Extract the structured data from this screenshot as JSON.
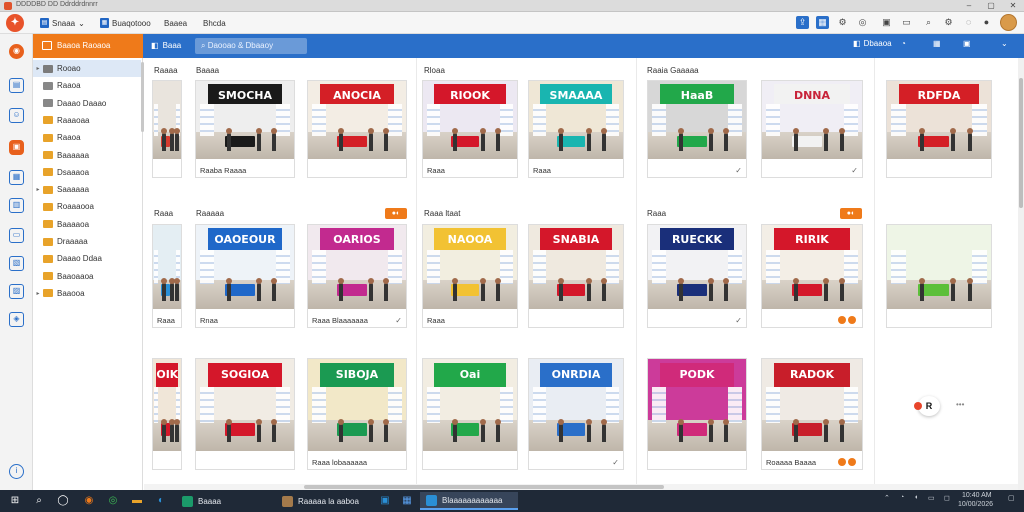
{
  "window": {
    "title": "DDDDBD DD Ddrddrdnnrr"
  },
  "toolbar": {
    "items": [
      {
        "label": "Snaaa",
        "chev": "⌄"
      },
      {
        "label": "Buaqotooo"
      },
      {
        "label": "Baaea"
      },
      {
        "label": "Bhcda"
      }
    ]
  },
  "header": {
    "section_label": "Baaoa Raoaoa",
    "back_label": "Baaa",
    "search_value": "Daooao & Dbaaoy",
    "buttons": [
      "Dbaaoa",
      "",
      "",
      ""
    ]
  },
  "tree": {
    "items": [
      {
        "label": "Rooao",
        "color": "#7b7b7b"
      },
      {
        "label": "Raaoa",
        "color": "#888888"
      },
      {
        "label": "Daaao Daaao",
        "color": "#888888"
      },
      {
        "label": "Raaaoaa",
        "color": "#e8a32a"
      },
      {
        "label": "Raaoa",
        "color": "#e8a32a"
      },
      {
        "label": "Baaaaaa",
        "color": "#e8a32a"
      },
      {
        "label": "Dsaaaoa",
        "color": "#e8a32a"
      },
      {
        "label": "Saaaaaa",
        "color": "#e8a32a"
      },
      {
        "label": "Roaaaooa",
        "color": "#e8a32a"
      },
      {
        "label": "Baaaaoa",
        "color": "#e8a32a"
      },
      {
        "label": "Draaaaa",
        "color": "#e8a32a"
      },
      {
        "label": "Daaao Ddaa",
        "color": "#e8a32a"
      },
      {
        "label": "Baaoaaoa",
        "color": "#e8a32a"
      },
      {
        "label": "Baaooa",
        "color": "#e8a32a"
      }
    ]
  },
  "groups": [
    {
      "label": "Raaaa"
    },
    {
      "label": "Baaaa"
    },
    {
      "label": "Rloaa"
    },
    {
      "label": "Raaia Gaaaaa"
    },
    {
      "label": "Raaa"
    },
    {
      "label": "Raaaaa"
    },
    {
      "label": "Raaa ltaat"
    },
    {
      "label": "Raaa"
    }
  ],
  "tiles": [
    {
      "sign": "",
      "caption": "",
      "sign_color": "#d63a2e",
      "wall": "#e9e4dd"
    },
    {
      "sign": "SMOCHA",
      "caption": "Raaba Raaaa",
      "sign_color": "#1a1a1a",
      "wall": "#eeeeee"
    },
    {
      "sign": "ANOCIA",
      "caption": "",
      "sign_color": "#d41f26",
      "wall": "#f3ede4"
    },
    {
      "sign": "RIOOK",
      "caption": "Raaa",
      "sign_color": "#d4172a",
      "wall": "#ece8f2"
    },
    {
      "sign": "SMAAAA",
      "caption": "Raaa",
      "sign_color": "#19b5b0",
      "wall": "#efe7d6"
    },
    {
      "sign": "HaaB",
      "caption": "",
      "sign_color": "#22a84a",
      "wall": "#d7d7d7"
    },
    {
      "sign": "DNNA",
      "caption": "",
      "sign_color": "#f2f2f2",
      "wall": "#f0eef5"
    },
    {
      "sign": "RDFDA",
      "caption": "",
      "sign_color": "#d41f26",
      "wall": "#ece2d8"
    },
    {
      "sign": "",
      "caption": "Raaa",
      "sign_color": "#2a8fd6",
      "wall": "#e4eef3"
    },
    {
      "sign": "OAOEOUR",
      "caption": "Rnaa",
      "sign_color": "#1f68c9",
      "wall": "#eef3f8"
    },
    {
      "sign": "OARIOS",
      "caption": "Raaa Blaaaaaaa",
      "sign_color": "#c22a8f",
      "wall": "#f1e9ee"
    },
    {
      "sign": "NAOOA",
      "caption": "Raaa",
      "sign_color": "#f2c233",
      "wall": "#f2eee0"
    },
    {
      "sign": "SNABIA",
      "caption": "",
      "sign_color": "#d4172a",
      "wall": "#efe9df"
    },
    {
      "sign": "RUECKK",
      "caption": "",
      "sign_color": "#1a2f7a",
      "wall": "#f2f2f4"
    },
    {
      "sign": "RIRIK",
      "caption": "",
      "sign_color": "#d4172a",
      "wall": "#f3eee6"
    },
    {
      "sign": "",
      "caption": "",
      "sign_color": "#5cbf3a",
      "wall": "#eef5e6"
    },
    {
      "sign": "OIK",
      "caption": "",
      "sign_color": "#d4172a",
      "wall": "#f0e6d8"
    },
    {
      "sign": "SOGIOA",
      "caption": "",
      "sign_color": "#d4172a",
      "wall": "#f1ece4"
    },
    {
      "sign": "SIBOJA",
      "caption": "Raaa lobaaaaaa",
      "sign_color": "#1b9a52",
      "wall": "#f2e8c8"
    },
    {
      "sign": "Oai",
      "caption": "",
      "sign_color": "#22a84a",
      "wall": "#f2ede2"
    },
    {
      "sign": "ONRDIA",
      "caption": "",
      "sign_color": "#2a6fc9",
      "wall": "#e9edf3"
    },
    {
      "sign": "PODK",
      "caption": "",
      "sign_color": "#d02a7a",
      "wall": "#cc3b9a"
    },
    {
      "sign": "RADOK",
      "caption": "Roaaaa Baaaa",
      "sign_color": "#c81e2a",
      "wall": "#efeae4"
    }
  ],
  "float": {
    "badge": "R",
    "dots": "•••"
  },
  "taskbar": {
    "apps": [
      {
        "label": "Baaaa",
        "color": "#1b9a6a"
      },
      {
        "label": "Raaaaa la aaboa",
        "color": "#a47a4b"
      },
      {
        "label": "Blaaaaaaaaaaaa",
        "color": "#2a8fd6"
      }
    ],
    "clock": "10:40 AM",
    "date": "10/00/2026"
  }
}
